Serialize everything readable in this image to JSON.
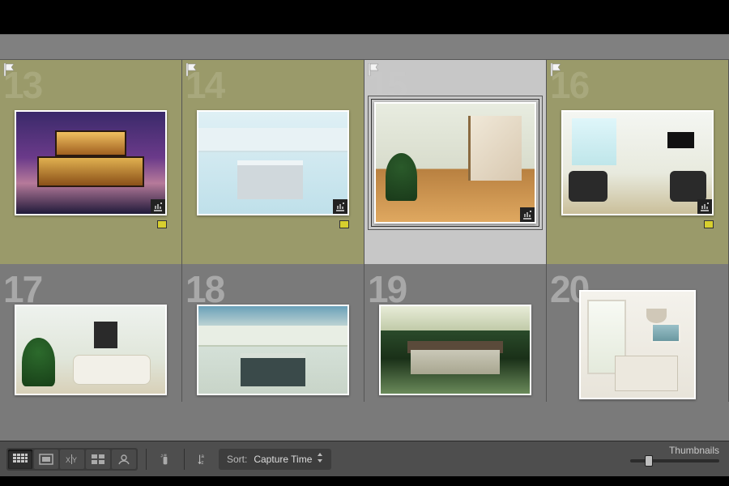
{
  "grid": {
    "row1": [
      {
        "index": "13",
        "flagged": true,
        "color_label": "yellow",
        "develop_badge": true,
        "selected": false,
        "thumb": "ph13"
      },
      {
        "index": "14",
        "flagged": true,
        "color_label": "yellow",
        "develop_badge": true,
        "selected": false,
        "thumb": "ph14"
      },
      {
        "index": "15",
        "flagged": true,
        "color_label": null,
        "develop_badge": true,
        "selected": true,
        "thumb": "ph15"
      },
      {
        "index": "16",
        "flagged": true,
        "color_label": "yellow",
        "develop_badge": true,
        "selected": false,
        "thumb": "ph16"
      }
    ],
    "row2": [
      {
        "index": "17",
        "flagged": false,
        "thumb": "ph17"
      },
      {
        "index": "18",
        "flagged": false,
        "thumb": "ph18"
      },
      {
        "index": "19",
        "flagged": false,
        "thumb": "ph19"
      },
      {
        "index": "20",
        "flagged": false,
        "thumb": "ph20"
      }
    ]
  },
  "toolbar": {
    "sort_label": "Sort:",
    "sort_value": "Capture Time",
    "thumbnails_label": "Thumbnails",
    "thumbnails_slider_percent": 18
  }
}
